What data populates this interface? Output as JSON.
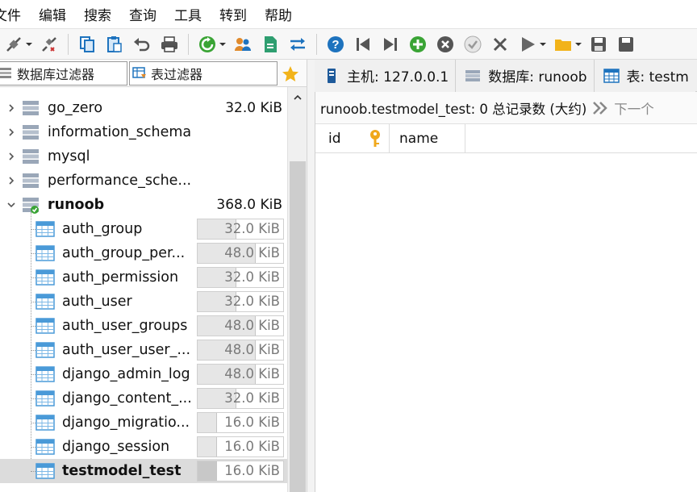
{
  "menu": [
    "文件",
    "编辑",
    "搜索",
    "查询",
    "工具",
    "转到",
    "帮助"
  ],
  "toolbar": {
    "icons": [
      "connect-icon",
      "disconnect-icon",
      "copy-icon",
      "paste-icon",
      "undo-icon",
      "print-icon",
      "refresh-icon",
      "user-manager-icon",
      "export-icon",
      "sync-icon",
      "help-icon",
      "first-record-icon",
      "last-record-icon",
      "add-record-icon",
      "delete-record-icon",
      "post-edit-icon",
      "cancel-edit-icon",
      "execute-icon",
      "open-file-icon",
      "save-icon"
    ]
  },
  "filters": {
    "db_filter_placeholder": "数据库过滤器",
    "table_filter_placeholder": "表过滤器"
  },
  "tabs": [
    {
      "label": "主机: 127.0.0.1",
      "icon": "host-icon"
    },
    {
      "label": "数据库: runoob",
      "icon": "database-icon"
    },
    {
      "label": "表: testm",
      "icon": "table-icon"
    }
  ],
  "tree": {
    "databases": [
      {
        "name": "go_zero",
        "size": "32.0 KiB",
        "expanded": false
      },
      {
        "name": "information_schema",
        "size": "",
        "expanded": false
      },
      {
        "name": "mysql",
        "size": "",
        "expanded": false
      },
      {
        "name": "performance_sche...",
        "size": "",
        "expanded": false
      },
      {
        "name": "runoob",
        "size": "368.0 KiB",
        "expanded": true
      }
    ],
    "tables": [
      {
        "name": "auth_group",
        "size_num": "32.0",
        "size_unit": "KiB",
        "fill": 0.67
      },
      {
        "name": "auth_group_per...",
        "size_num": "48.0",
        "size_unit": "KiB",
        "fill": 1.0
      },
      {
        "name": "auth_permission",
        "size_num": "32.0",
        "size_unit": "KiB",
        "fill": 0.67
      },
      {
        "name": "auth_user",
        "size_num": "32.0",
        "size_unit": "KiB",
        "fill": 0.67
      },
      {
        "name": "auth_user_groups",
        "size_num": "48.0",
        "size_unit": "KiB",
        "fill": 1.0
      },
      {
        "name": "auth_user_user_...",
        "size_num": "48.0",
        "size_unit": "KiB",
        "fill": 1.0
      },
      {
        "name": "django_admin_log",
        "size_num": "48.0",
        "size_unit": "KiB",
        "fill": 1.0
      },
      {
        "name": "django_content_...",
        "size_num": "32.0",
        "size_unit": "KiB",
        "fill": 0.67
      },
      {
        "name": "django_migratio...",
        "size_num": "16.0",
        "size_unit": "KiB",
        "fill": 0.33
      },
      {
        "name": "django_session",
        "size_num": "16.0",
        "size_unit": "KiB",
        "fill": 0.33
      },
      {
        "name": "testmodel_test",
        "size_num": "16.0",
        "size_unit": "KiB",
        "fill": 0.33,
        "selected": true
      }
    ]
  },
  "infobar": {
    "summary": "runoob.testmodel_test: 0 总记录数 (大约)",
    "next": "下一个"
  },
  "grid": {
    "columns": [
      "id",
      "name"
    ]
  },
  "colors": {
    "accent_blue": "#1e73be",
    "green": "#3aa435",
    "star_gold": "#f2b31a",
    "key_gold": "#f0a81c"
  }
}
